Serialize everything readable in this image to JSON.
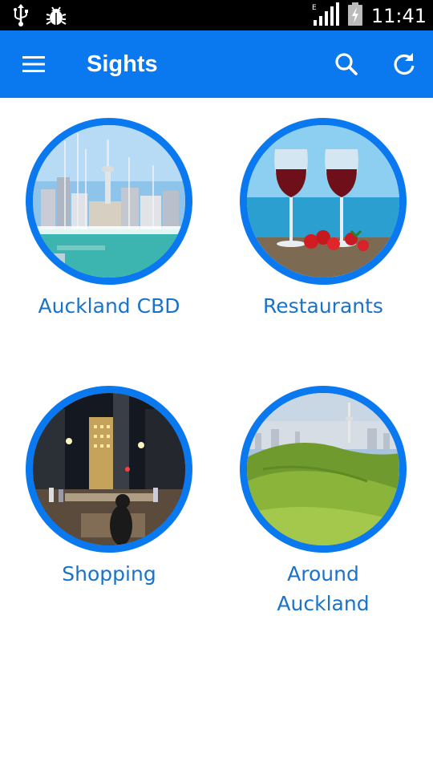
{
  "status_bar": {
    "time": "11:41",
    "icons": [
      "usb-icon",
      "debug-bug-icon",
      "signal-icon",
      "battery-charging-icon"
    ],
    "network_type": "E"
  },
  "app_bar": {
    "title": "Sights",
    "icons": [
      "menu-icon",
      "search-icon",
      "refresh-icon"
    ],
    "color": "#0a79f0"
  },
  "tiles": [
    {
      "label": "Auckland CBD",
      "image": "city-skyline-marina"
    },
    {
      "label": "Restaurants",
      "image": "wine-glasses-strawberries"
    },
    {
      "label": "Shopping",
      "image": "city-street-night"
    },
    {
      "label": "Around\nAuckland",
      "image": "green-hill-city-view"
    }
  ],
  "colors": {
    "accent": "#0a79f0",
    "label": "#1a73c8"
  }
}
